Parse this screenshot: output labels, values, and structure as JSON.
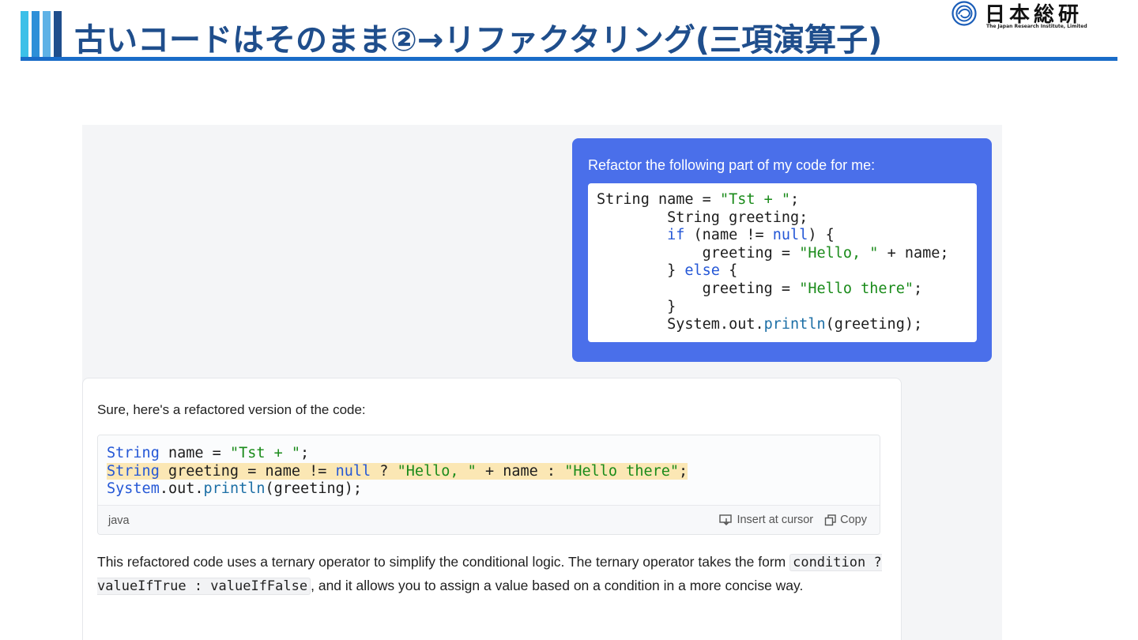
{
  "slide": {
    "title": "古いコードはそのまま②→リファクタリング(三項演算子)",
    "accent_colors": [
      "#3cc0e8",
      "#2d8fd8",
      "#1f4e8c"
    ],
    "rule_color": "#1a6cc8"
  },
  "logo": {
    "name": "日本総研",
    "subtitle": "The Japan Research Institute, Limited",
    "icon": "jri-logo-icon"
  },
  "chat": {
    "user_message": {
      "prompt": "Refactor the following part of my code for me:",
      "code_lines": [
        [
          {
            "t": "String name = ",
            "c": "plain"
          },
          {
            "t": "\"Tst + \"",
            "c": "str"
          },
          {
            "t": ";",
            "c": "plain"
          }
        ],
        [
          {
            "t": "        String greeting;",
            "c": "plain"
          }
        ],
        [
          {
            "t": "        ",
            "c": "plain"
          },
          {
            "t": "if",
            "c": "kw"
          },
          {
            "t": " (name != ",
            "c": "plain"
          },
          {
            "t": "null",
            "c": "kw"
          },
          {
            "t": ") {",
            "c": "plain"
          }
        ],
        [
          {
            "t": "            greeting = ",
            "c": "plain"
          },
          {
            "t": "\"Hello, \"",
            "c": "str"
          },
          {
            "t": " + name;",
            "c": "plain"
          }
        ],
        [
          {
            "t": "        } ",
            "c": "plain"
          },
          {
            "t": "else",
            "c": "kw"
          },
          {
            "t": " {",
            "c": "plain"
          }
        ],
        [
          {
            "t": "            greeting = ",
            "c": "plain"
          },
          {
            "t": "\"Hello there\"",
            "c": "str"
          },
          {
            "t": ";",
            "c": "plain"
          }
        ],
        [
          {
            "t": "        }",
            "c": "plain"
          }
        ],
        [
          {
            "t": "        System.out.",
            "c": "plain"
          },
          {
            "t": "println",
            "c": "method"
          },
          {
            "t": "(greeting);",
            "c": "plain"
          }
        ]
      ]
    },
    "assistant_message": {
      "intro": "Sure, here's a refactored version of the code:",
      "code_lines": [
        {
          "highlight": false,
          "tokens": [
            {
              "t": "String",
              "c": "type"
            },
            {
              "t": " name = ",
              "c": "plain"
            },
            {
              "t": "\"Tst + \"",
              "c": "str"
            },
            {
              "t": ";",
              "c": "plain"
            }
          ]
        },
        {
          "highlight": true,
          "tokens": [
            {
              "t": "String",
              "c": "type"
            },
            {
              "t": " greeting = name != ",
              "c": "plain"
            },
            {
              "t": "null",
              "c": "kw"
            },
            {
              "t": " ? ",
              "c": "plain"
            },
            {
              "t": "\"Hello, \"",
              "c": "str"
            },
            {
              "t": " + name : ",
              "c": "plain"
            },
            {
              "t": "\"Hello there\"",
              "c": "str"
            },
            {
              "t": ";",
              "c": "plain"
            }
          ]
        },
        {
          "highlight": false,
          "tokens": [
            {
              "t": "System",
              "c": "type"
            },
            {
              "t": ".out.",
              "c": "plain"
            },
            {
              "t": "println",
              "c": "method"
            },
            {
              "t": "(greeting);",
              "c": "plain"
            }
          ]
        }
      ],
      "language": "java",
      "insert_label": "Insert at cursor",
      "copy_label": "Copy",
      "explanation_before": "This refactored code uses a ternary operator to simplify the conditional logic. The ternary operator takes the form ",
      "explanation_code": "condition ? valueIfTrue : valueIfFalse",
      "explanation_after": ", and it allows you to assign a value based on a condition in a more concise way."
    }
  }
}
